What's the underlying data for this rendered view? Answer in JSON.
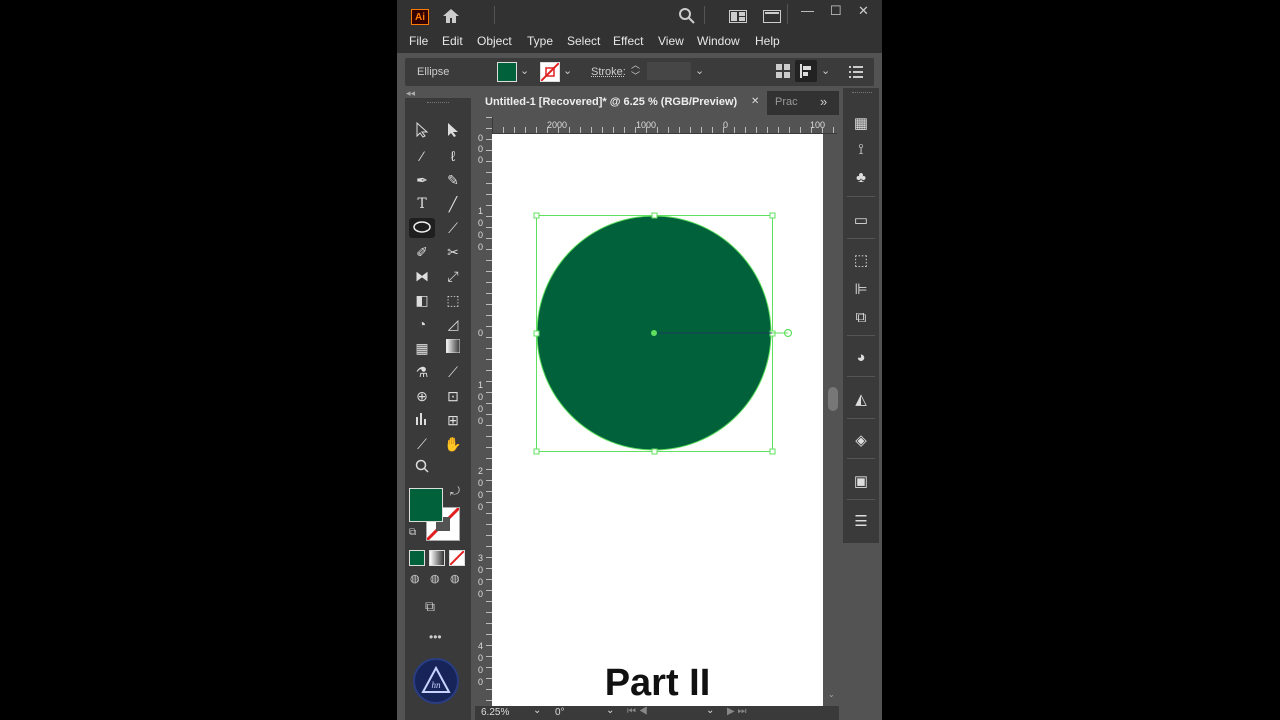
{
  "app": {
    "logo": "Ai"
  },
  "titlebar": {
    "icons": [
      "home-icon",
      "search-icon",
      "arrange-documents-icon",
      "workspace-icon"
    ]
  },
  "window_controls": {
    "minimize": "—",
    "maximize": "☐",
    "close": "✕"
  },
  "menu": [
    "File",
    "Edit",
    "Object",
    "Type",
    "Select",
    "Effect",
    "View",
    "Window",
    "Help"
  ],
  "control_bar": {
    "object_label": "Ellipse",
    "fill_color": "#00613a",
    "stroke_label": "Stroke:",
    "stroke_value": ""
  },
  "document_tab": {
    "title": "Untitled-1 [Recovered]* @ 6.25 % (RGB/Preview)",
    "close": "✕",
    "next_tab": "Prac",
    "overflow": "»"
  },
  "ruler": {
    "horizontal": [
      "2000",
      "1000",
      "0",
      "100"
    ],
    "vertical": [
      {
        "digits": [
          "0",
          "0",
          "0"
        ]
      },
      {
        "digits": [
          "1",
          "0",
          "0",
          "0"
        ]
      },
      {
        "digits": [
          "0"
        ]
      },
      {
        "digits": [
          "1",
          "0",
          "0",
          "0"
        ]
      },
      {
        "digits": [
          "2",
          "0",
          "0",
          "0"
        ]
      },
      {
        "digits": [
          "3",
          "0",
          "0",
          "0"
        ]
      },
      {
        "digits": [
          "4",
          "0",
          "0",
          "0"
        ]
      }
    ]
  },
  "artboard": {
    "shape": "ellipse",
    "fill": "#00613a",
    "selection_color": "#5fe05f",
    "caption": "Part II"
  },
  "toolbar": {
    "fill_color": "#00613a",
    "more": "•••"
  },
  "status_bar": {
    "zoom": "6.25%",
    "rotation": "0°"
  }
}
